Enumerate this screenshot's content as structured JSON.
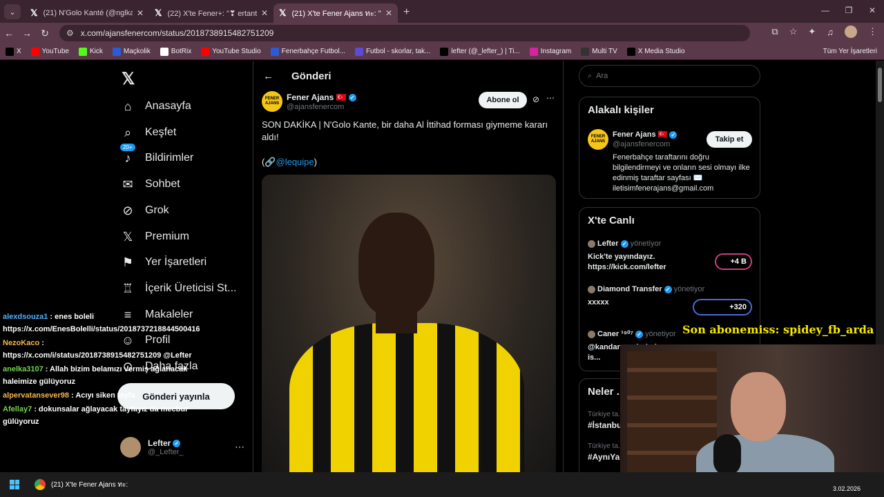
{
  "browser": {
    "tabs": [
      {
        "title": "(21) N'Golo Kanté (@nglkante)",
        "active": false
      },
      {
        "title": "(22) X'te Fener+: \"❣ ertantorun",
        "active": false
      },
      {
        "title": "(21) X'te Fener Ajans ทะ: \"SON D",
        "active": true
      }
    ],
    "url": "x.com/ajansfenercom/status/2018738915482751209",
    "bookmarks": [
      {
        "label": "X",
        "icon": "x-icon",
        "color": "#000000"
      },
      {
        "label": "YouTube",
        "icon": "youtube-icon",
        "color": "#ff0000"
      },
      {
        "label": "Kick",
        "icon": "kick-icon",
        "color": "#53fc18"
      },
      {
        "label": "Maçkolik",
        "icon": "mackolik-icon",
        "color": "#2b5bd7"
      },
      {
        "label": "BotRix",
        "icon": "botrix-icon",
        "color": "#ffffff"
      },
      {
        "label": "YouTube Studio",
        "icon": "youtube-studio-icon",
        "color": "#ff0000"
      },
      {
        "label": "Fenerbahçe Futbol...",
        "icon": "fenerbahce-icon",
        "color": "#2b5bd7"
      },
      {
        "label": "Futbol - skorlar, tak...",
        "icon": "futbol-icon",
        "color": "#5b4bd7"
      },
      {
        "label": "lefter (@_lefter_) | Ti...",
        "icon": "tiktok-icon",
        "color": "#000000"
      },
      {
        "label": "Instagram",
        "icon": "instagram-icon",
        "color": "#d6249f"
      },
      {
        "label": "Multi TV",
        "icon": "multitv-icon",
        "color": "#333333"
      },
      {
        "label": "X Media Studio",
        "icon": "x-icon",
        "color": "#000000"
      }
    ],
    "bookmarks_folder": "Tüm Yer İşaretleri"
  },
  "nav": {
    "items": [
      {
        "label": "Anasayfa",
        "icon": "home-icon",
        "glyph": "⌂"
      },
      {
        "label": "Keşfet",
        "icon": "search-icon",
        "glyph": "⌕"
      },
      {
        "label": "Bildirimler",
        "icon": "bell-icon",
        "glyph": "♪"
      },
      {
        "label": "Sohbet",
        "icon": "mail-icon",
        "glyph": "✉"
      },
      {
        "label": "Grok",
        "icon": "grok-icon",
        "glyph": "⊘"
      },
      {
        "label": "Premium",
        "icon": "x-premium-icon",
        "glyph": "𝕏"
      },
      {
        "label": "Yer İşaretleri",
        "icon": "bookmark-icon",
        "glyph": "⚑"
      },
      {
        "label": "İçerik Üreticisi St...",
        "icon": "creator-icon",
        "glyph": "♖"
      },
      {
        "label": "Makaleler",
        "icon": "article-icon",
        "glyph": "≡"
      },
      {
        "label": "Profil",
        "icon": "profile-icon",
        "glyph": "☺"
      },
      {
        "label": "Daha fazla",
        "icon": "more-circle-icon",
        "glyph": "⊙"
      }
    ],
    "notif_badge": "20+",
    "post_button": "Gönderi yayınla",
    "profile": {
      "name": "Lefter",
      "handle": "@_Lefter_"
    }
  },
  "chat": [
    {
      "user": "alexdsouza1",
      "text": ": enes boleli https://x.com/EnesBolelli/status/2018737218844500416",
      "color": "u"
    },
    {
      "user": "NezoKaco",
      "text": ": https://x.com/i/status/2018738915482751209 @Lefter",
      "color": "u2"
    },
    {
      "user": "anelka3107",
      "text": ": Allah bizim belamızı vermiş ağlanacak haleimize gülüyoruz",
      "color": "u3"
    },
    {
      "user": "alpervatansever98",
      "text": ": Acıyı siken tayfa",
      "color": "u2"
    },
    {
      "user": "Afellay7",
      "text": ": dokunsalar ağlayacak tayfayız da mecbur gülüyoruz",
      "color": "u3"
    }
  ],
  "post": {
    "header": "Gönderi",
    "author_name": "Fener Ajans",
    "author_flag": "🇹🇷",
    "author_handle": "@ajansfenercom",
    "avatar_text": "FENER AJANS",
    "subscribe": "Abone ol",
    "text": "SON DAKİKA | N'Golo Kante, bir daha Al İttihad forması giymeme kararı aldı!",
    "mention_prefix": "(🔗",
    "mention": "@lequipe",
    "mention_suffix": ")"
  },
  "sidebar": {
    "search_placeholder": "Ara",
    "related_title": "Alakalı kişiler",
    "related": {
      "name": "Fener Ajans",
      "flag": "🇹🇷",
      "handle": "@ajansfenercom",
      "follow": "Takip et",
      "bio": "Fenerbahçe taraftarını doğru bilgilendirmeyi ve onların sesi olmayı ilke edinmiş taraftar sayfası ✉️ iletisimfenerajans@gmail.com"
    },
    "live_title": "X'te Canlı",
    "live": [
      {
        "user": "Lefter",
        "role": "yönetiyor",
        "text": "Kick'te yayındayız. https://kick.com/lefter",
        "count": "+4 B"
      },
      {
        "user": "Diamond Transfer",
        "role": "yönetiyor",
        "text": "xxxxx",
        "count": "+320"
      },
      {
        "user": "Caner ¹⁹⁰⁷",
        "role": "yönetiyor",
        "text": "@kandany... derhal is...",
        "count": ""
      }
    ],
    "news_title": "Neler ...",
    "trends": [
      {
        "context": "Türkiye ta...",
        "tag": "#İstanbu..."
      },
      {
        "context": "Türkiye ta...",
        "tag": "#AynıYa..."
      }
    ]
  },
  "stream_overlay": "Son abonemiss: spidey_fb_arda",
  "taskbar": {
    "app": "(21) X'te Fener Ajans ทะ:",
    "date": "3.02.2026"
  }
}
